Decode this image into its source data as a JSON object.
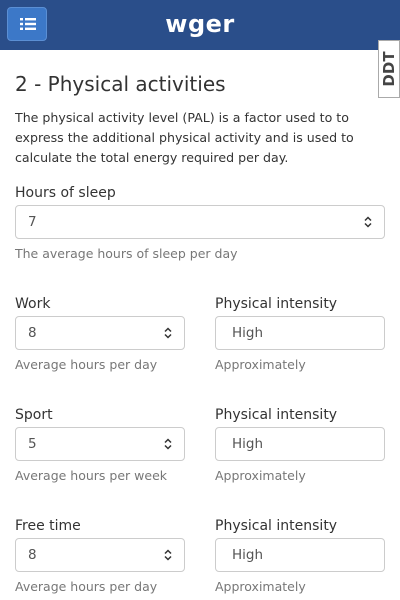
{
  "app": {
    "brand": "wger"
  },
  "badge": {
    "text": "DDT"
  },
  "page": {
    "title": "2 - Physical activities",
    "intro": "The physical activity level (PAL) is a factor used to to express the additional physical activity and is used to calculate the total energy required per day."
  },
  "sleep": {
    "label": "Hours of sleep",
    "value": "7",
    "help": "The average hours of sleep per day"
  },
  "work": {
    "label": "Work",
    "value": "8",
    "help": "Average hours per day",
    "intensity_label": "Physical intensity",
    "intensity_value": "High",
    "intensity_help": "Approximately"
  },
  "sport": {
    "label": "Sport",
    "value": "5",
    "help": "Average hours per week",
    "intensity_label": "Physical intensity",
    "intensity_value": "High",
    "intensity_help": "Approximately"
  },
  "freetime": {
    "label": "Free time",
    "value": "8",
    "help": "Average hours per day",
    "intensity_label": "Physical intensity",
    "intensity_value": "High",
    "intensity_help": "Approximately"
  },
  "icons": {
    "menu": "list-icon",
    "spinner": "updown-chevron-icon"
  },
  "colors": {
    "navbar": "#2a4e8a",
    "menu_button": "#3c78c8",
    "text": "#333333",
    "help_text": "#777777",
    "input_border": "#cccccc"
  }
}
